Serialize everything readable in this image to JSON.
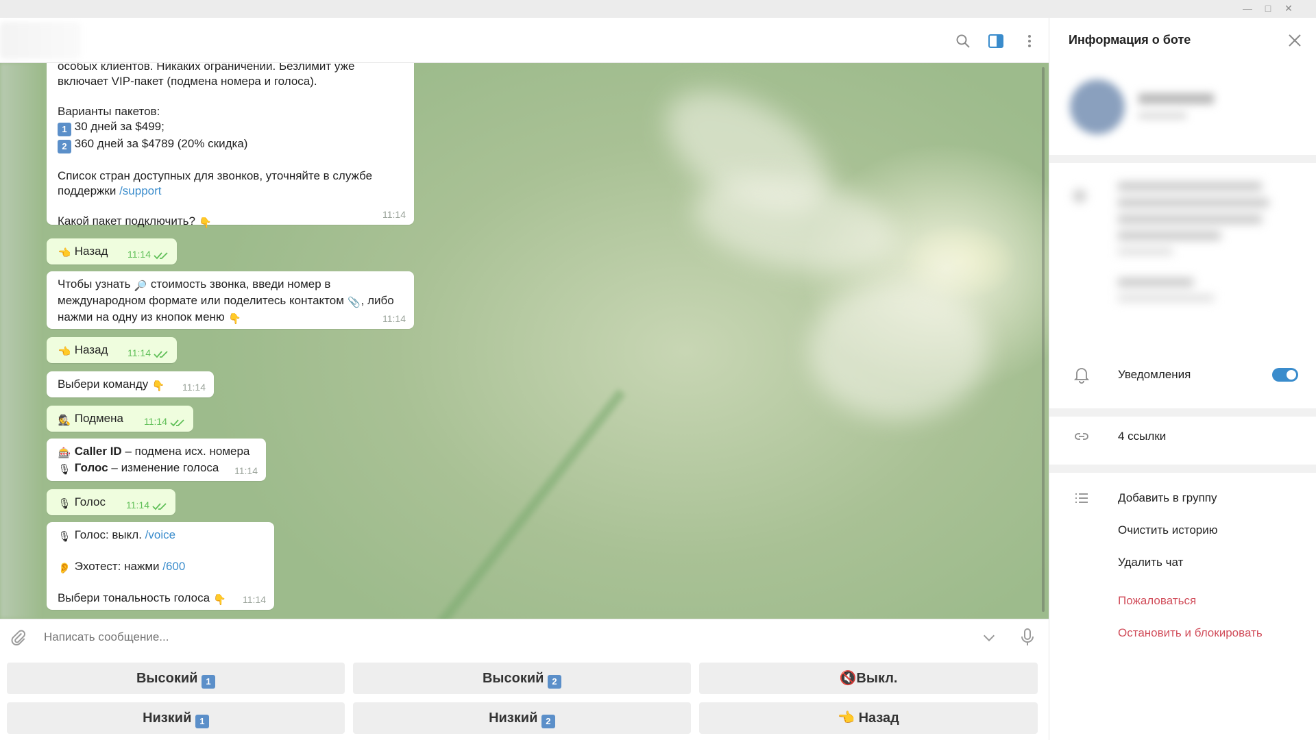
{
  "window": {
    "minimize": "—",
    "maximize": "□",
    "close": "✕"
  },
  "header": {
    "search_icon": "search-icon",
    "panel_icon": "sidebar-toggle-icon",
    "menu_icon": "more-vertical-icon"
  },
  "messages": {
    "m1": {
      "lines": [
        "особых клиентов. Никаких ограничений. Безлимит уже",
        "включает VIP-пакет (подмена номера и голоса)."
      ],
      "packages_title": "Варианты пакетов:",
      "pkg1_num": "1",
      "pkg1": "30 дней за $499;",
      "pkg2_num": "2",
      "pkg2": "360 дней за $4789 (20% скидка)",
      "countries_line1": "Список стран доступных для звонков, уточняйте в службе",
      "countries_line2": "поддержки ",
      "support_link": "/support",
      "question": "Какой пакет подключить? ",
      "question_emoji": "👇",
      "time": "11:14"
    },
    "m2": {
      "emoji": "👈",
      "text": "Назад",
      "time": "11:14"
    },
    "m3": {
      "line1a": "Чтобы узнать ",
      "line1_emoji": "🔎",
      "line1b": " стоимость звонка, введи номер в",
      "line2a": "международном формате или поделитесь контактом ",
      "line2_emoji": "📎",
      "line2b": ", либо",
      "line3": "нажми на одну из кнопок меню ",
      "line3_emoji": "👇",
      "time": "11:14"
    },
    "m4": {
      "emoji": "👈",
      "text": "Назад",
      "time": "11:14"
    },
    "m5": {
      "text": "Выбери команду ",
      "emoji": "👇",
      "time": "11:14"
    },
    "m6": {
      "emoji": "🕵",
      "text": "Подмена",
      "time": "11:14"
    },
    "m7": {
      "l1_emoji": "🎰",
      "l1_bold": "Caller ID",
      "l1_rest": " – подмена исх. номера",
      "l2_emoji": "🎙",
      "l2_bold": "Голос",
      "l2_rest": " – изменение голоса",
      "time": "11:14"
    },
    "m8": {
      "emoji": "🎙",
      "text": "Голос",
      "time": "11:14"
    },
    "m9": {
      "l1_emoji": "🎙",
      "l1_text": "Голос: выкл. ",
      "l1_link": "/voice",
      "l2_emoji": "👂",
      "l2_text": "Эхотест: нажми ",
      "l2_link": "/600",
      "l3_text": "Выбери тональность голоса ",
      "l3_emoji": "👇",
      "time": "11:14"
    }
  },
  "composer": {
    "placeholder": "Написать сообщение..."
  },
  "keyboard": {
    "b1": {
      "label": "Высокий ",
      "num": "1"
    },
    "b2": {
      "label": "Высокий ",
      "num": "2"
    },
    "b3": {
      "emoji": "🔇",
      "label": "Выкл."
    },
    "b4": {
      "label": "Низкий ",
      "num": "1"
    },
    "b5": {
      "label": "Низкий ",
      "num": "2"
    },
    "b6": {
      "emoji": "👈",
      "label": " Назад"
    }
  },
  "right_panel": {
    "title": "Информация о боте",
    "notifications": "Уведомления",
    "notifications_on": true,
    "links": "4 ссылки",
    "add_to_group": "Добавить в группу",
    "clear_history": "Очистить историю",
    "delete_chat": "Удалить чат",
    "report": "Пожаловаться",
    "stop_block": "Остановить и блокировать"
  },
  "colors": {
    "accent": "#3a8ccc",
    "outgoing_bubble": "#effdde",
    "danger": "#d14e5b",
    "check_green": "#5fbf57"
  }
}
